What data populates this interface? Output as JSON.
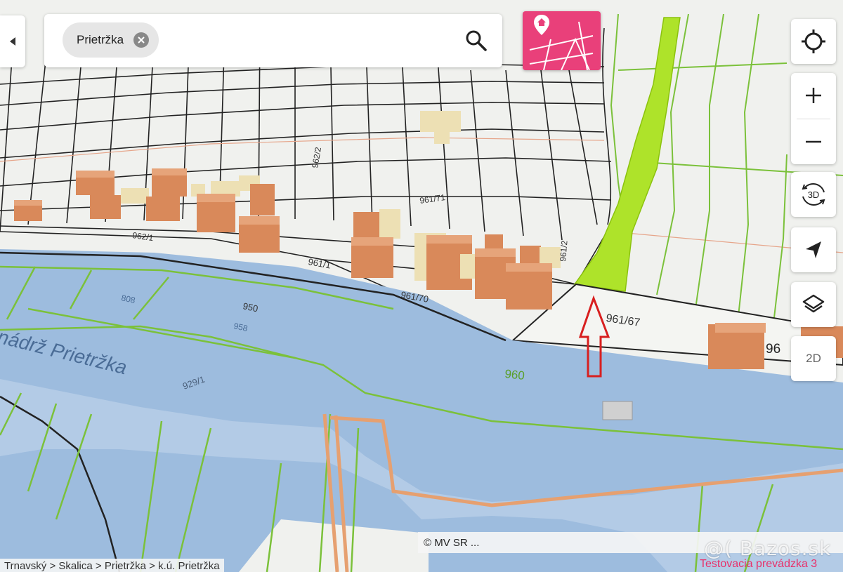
{
  "search": {
    "chip_label": "Prietržka"
  },
  "controls": {
    "mode_3d_label": "3D",
    "mode_2d_label": "2D"
  },
  "map": {
    "labels": [
      "961/67",
      "960",
      "961/1",
      "961/70",
      "961/2",
      "961/71",
      "962/1",
      "962/2",
      "950",
      "929/1",
      "958",
      "808",
      "96"
    ],
    "water_label": "nádrž Prietržka",
    "colors": {
      "water": "#9dbcde",
      "land": "#f0f1ee",
      "highlight_parcel": "#aee32a",
      "building_dark": "#d9895a",
      "building_light": "#ede0b4",
      "parcel_line": "#222222",
      "green_line": "#7bc13a",
      "arrow": "#d81f1f"
    }
  },
  "attribution": "© MV SR ...",
  "breadcrumb": "Trnavský > Skalica > Prietržka > k.ú. Prietržka",
  "watermark": "@( Bazos.sk",
  "status": "Testovacia prevádzka 3"
}
